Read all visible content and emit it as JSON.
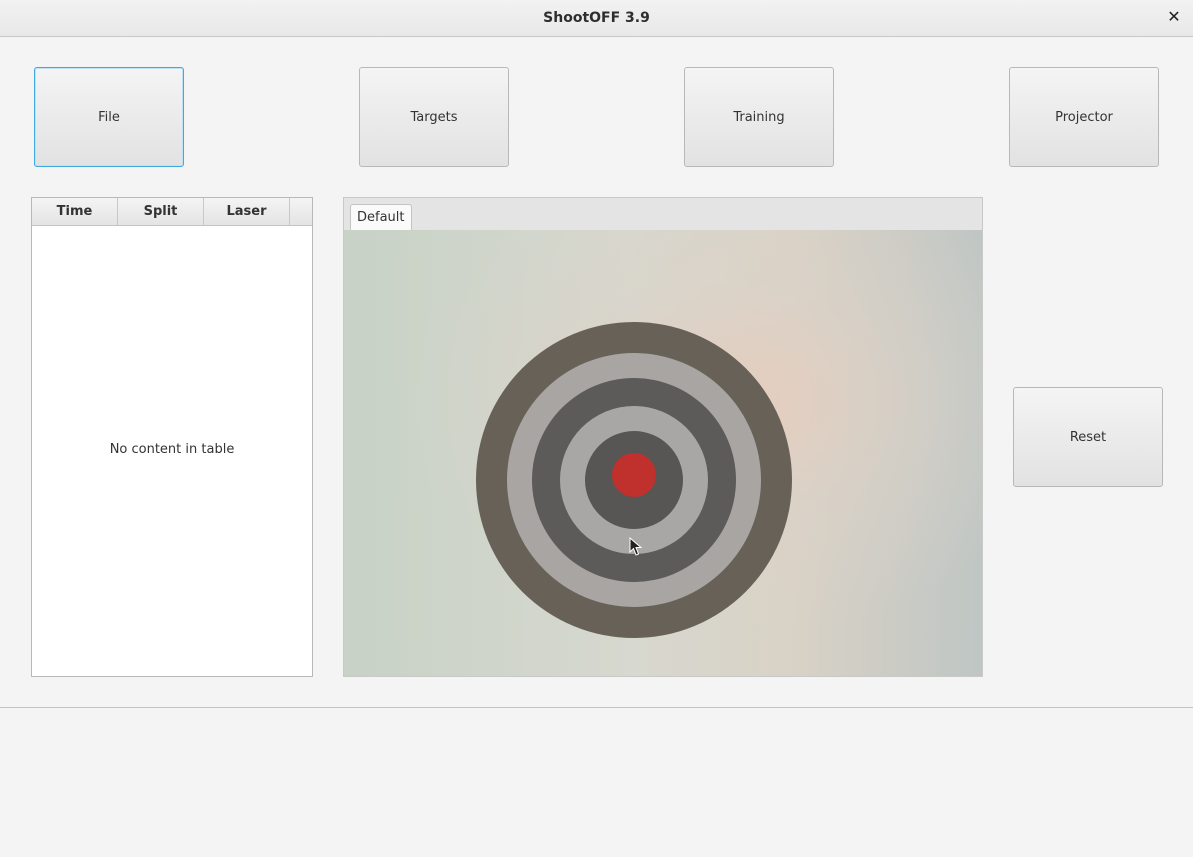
{
  "window": {
    "title": "ShootOFF 3.9",
    "close_symbol": "✕"
  },
  "toolbar": {
    "file_label": "File",
    "targets_label": "Targets",
    "training_label": "Training",
    "projector_label": "Projector"
  },
  "shot_table": {
    "columns": [
      "Time",
      "Split",
      "Laser"
    ],
    "rows": [],
    "empty_message": "No content in table"
  },
  "camera_tabs": [
    {
      "label": "Default",
      "selected": true
    }
  ],
  "camera_feed": {
    "target": "bullseye-target",
    "bullseye_color": "#c0302c",
    "ring_dark_color": "#676158",
    "ring_light_color": "#a8a5a3"
  },
  "controls": {
    "reset_label": "Reset"
  },
  "colors": {
    "focus_border": "#3fa9e0",
    "background": "#f4f4f4"
  }
}
